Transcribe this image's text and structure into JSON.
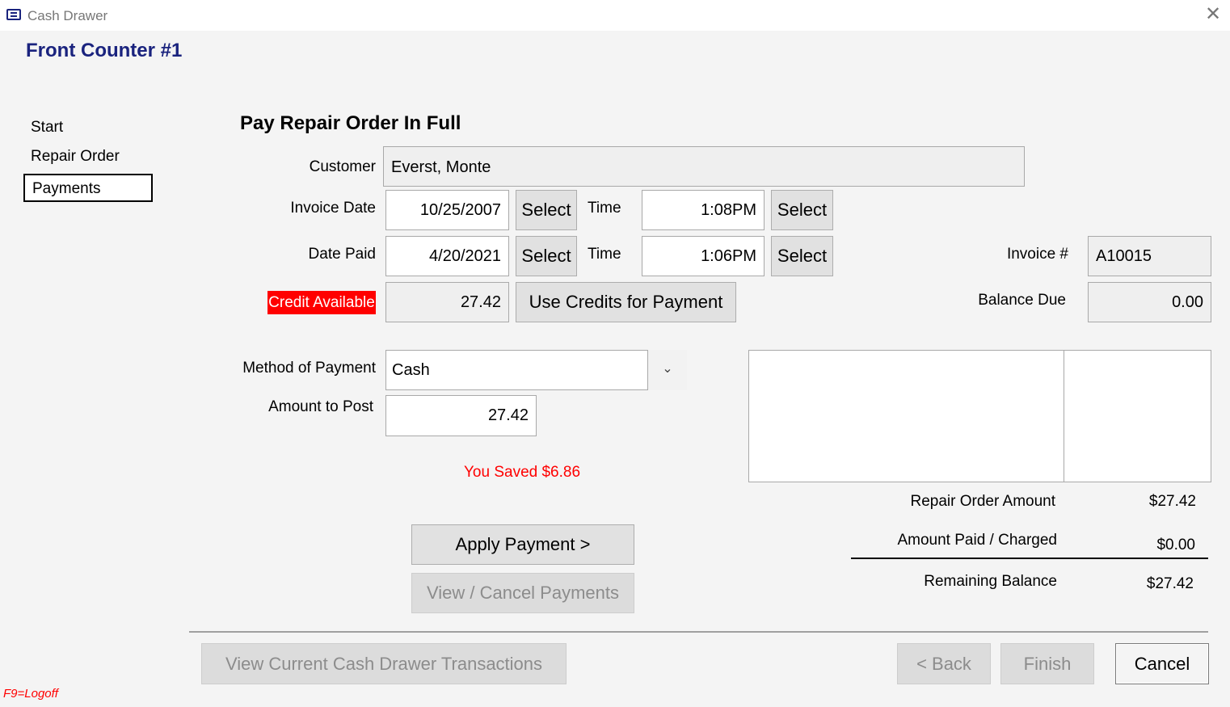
{
  "window": {
    "title": "Cash Drawer",
    "close_glyph": "✕",
    "icon": "window-app-icon"
  },
  "header": {
    "counter_name": "Front Counter #1"
  },
  "nav": {
    "items": [
      {
        "label": "Start"
      },
      {
        "label": "Repair Order"
      },
      {
        "label": "Payments"
      }
    ],
    "active": "Payments"
  },
  "form": {
    "title": "Pay Repair Order In Full",
    "customer": {
      "label": "Customer",
      "value": "Everst, Monte"
    },
    "invoice_date": {
      "label": "Invoice Date",
      "value": "10/25/2007",
      "select_label": "Select",
      "time_label": "Time",
      "time_value": "1:08PM",
      "time_select_label": "Select"
    },
    "date_paid": {
      "label": "Date Paid",
      "value": "4/20/2021",
      "select_label": "Select",
      "time_label": "Time",
      "time_value": "1:06PM",
      "time_select_label": "Select"
    },
    "credit": {
      "label": "Credit Available",
      "value": "27.42",
      "button_label": "Use Credits for Payment",
      "label_color": "#ff0000"
    },
    "invoice_number": {
      "label": "Invoice #",
      "value": "A10015"
    },
    "balance_due": {
      "label": "Balance Due",
      "value": "0.00"
    },
    "method_of_payment": {
      "label": "Method of Payment",
      "value": "Cash"
    },
    "amount_to_post": {
      "label": "Amount to Post",
      "value": "27.42"
    },
    "saved_message": "You Saved $6.86",
    "apply_payment_label": "Apply Payment >",
    "view_cancel_label": "View / Cancel Payments"
  },
  "summary": {
    "repair_order_amount": {
      "label": "Repair Order Amount",
      "value": "$27.42"
    },
    "amount_paid": {
      "label": "Amount Paid / Charged",
      "value": "$0.00"
    },
    "remaining_balance": {
      "label": "Remaining Balance",
      "value": "$27.42"
    }
  },
  "footer": {
    "view_transactions_label": "View Current Cash Drawer Transactions",
    "back_label": "< Back",
    "finish_label": "Finish",
    "cancel_label": "Cancel",
    "logoff_hint": "F9=Logoff"
  },
  "colors": {
    "accent": "#1a237e",
    "alert": "#ff0000",
    "background": "#f4f4f4"
  }
}
